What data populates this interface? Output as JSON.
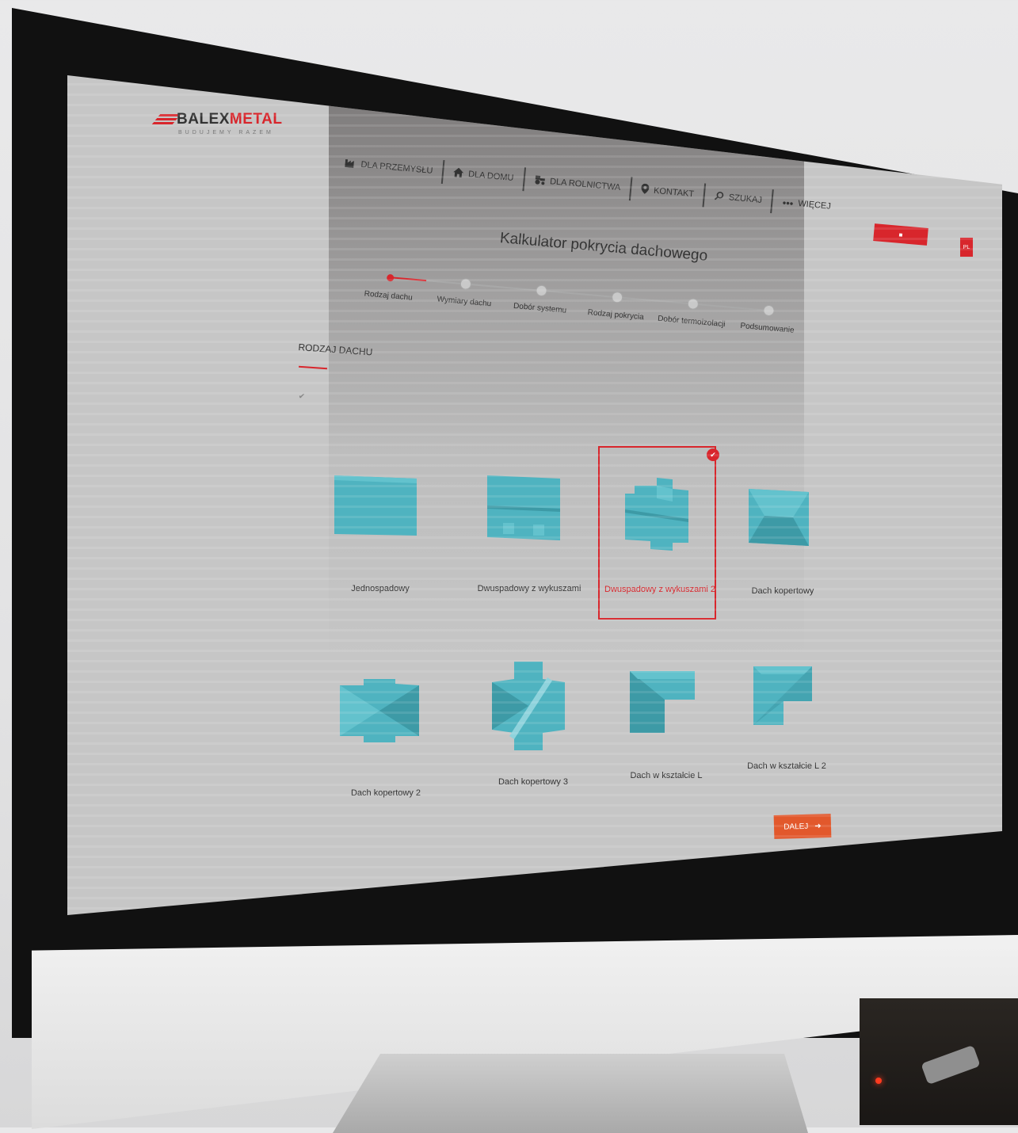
{
  "logo": {
    "brand_a": "BALEX",
    "brand_b": "METAL",
    "tagline": "BUDUJEMY RAZEM"
  },
  "nav": [
    {
      "label": "DLA PRZEMYSŁU",
      "icon": "factory-icon"
    },
    {
      "label": "DLA DOMU",
      "icon": "home-icon"
    },
    {
      "label": "DLA ROLNICTWA",
      "icon": "tractor-icon"
    },
    {
      "label": "KONTAKT",
      "icon": "location-pin-icon"
    },
    {
      "label": "SZUKAJ",
      "icon": "search-icon"
    },
    {
      "label": "WIĘCEJ",
      "icon": "more-icon"
    }
  ],
  "header": {
    "title": "Kalkulator pokrycia dachowego",
    "lang": "PL"
  },
  "steps": [
    {
      "label": "Rodzaj dachu",
      "active": true
    },
    {
      "label": "Wymiary dachu",
      "active": false
    },
    {
      "label": "Dobór systemu",
      "active": false
    },
    {
      "label": "Rodzaj pokrycia",
      "active": false
    },
    {
      "label": "Dobór termoizolacji",
      "active": false
    },
    {
      "label": "Podsumowanie",
      "active": false
    }
  ],
  "section": {
    "title": "RODZAJ DACHU"
  },
  "roofs": [
    {
      "label": "Jednospadowy",
      "icon": "mono-pitch-roof-icon",
      "selected": false
    },
    {
      "label": "Dwuspadowy z wykuszami",
      "icon": "gable-roof-dormers-icon",
      "selected": false
    },
    {
      "label": "Dwuspadowy z wykuszami 2",
      "icon": "gable-roof-dormers-2-icon",
      "selected": true
    },
    {
      "label": "Dach kopertowy",
      "icon": "hip-roof-icon",
      "selected": false
    },
    {
      "label": "Dach kopertowy 2",
      "icon": "hip-roof-2-icon",
      "selected": false
    },
    {
      "label": "Dach kopertowy 3",
      "icon": "hip-roof-3-icon",
      "selected": false
    },
    {
      "label": "Dach w kształcie L",
      "icon": "l-shaped-roof-icon",
      "selected": false
    },
    {
      "label": "Dach w kształcie L 2",
      "icon": "l-shaped-roof-2-icon",
      "selected": false
    }
  ],
  "actions": {
    "next": "DALEJ"
  },
  "colors": {
    "accent": "#d8262c",
    "next_button": "#e2582c",
    "roof_tile": "#4fb3c0",
    "screen_bg": "#c6c6c6"
  }
}
